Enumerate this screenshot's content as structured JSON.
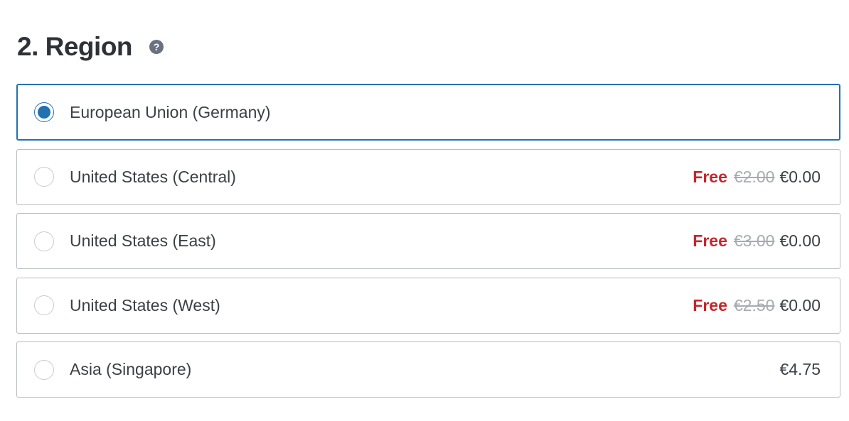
{
  "section": {
    "title": "2. Region",
    "help_icon": "question-mark-icon"
  },
  "colors": {
    "accent": "#2271b1",
    "free": "#c2272d",
    "strikethrough": "#a7abb0"
  },
  "regions": [
    {
      "label": "European Union (Germany)",
      "selected": true,
      "free_label": "",
      "old_price": "",
      "price": ""
    },
    {
      "label": "United States (Central)",
      "selected": false,
      "free_label": "Free",
      "old_price": "€2.00",
      "price": "€0.00"
    },
    {
      "label": "United States (East)",
      "selected": false,
      "free_label": "Free",
      "old_price": "€3.00",
      "price": "€0.00"
    },
    {
      "label": "United States (West)",
      "selected": false,
      "free_label": "Free",
      "old_price": "€2.50",
      "price": "€0.00"
    },
    {
      "label": "Asia (Singapore)",
      "selected": false,
      "free_label": "",
      "old_price": "",
      "price": "€4.75"
    }
  ]
}
